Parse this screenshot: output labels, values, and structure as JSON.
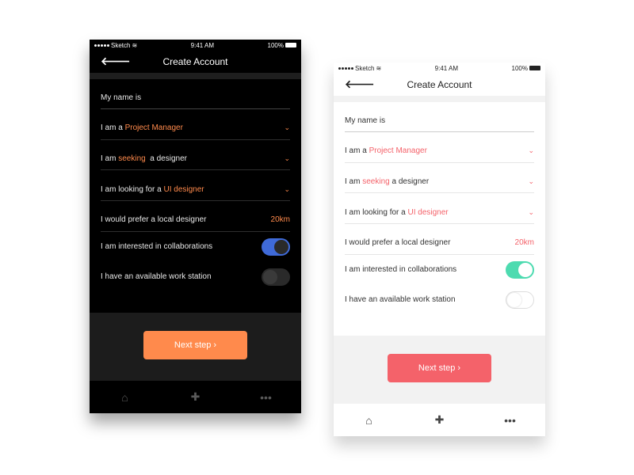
{
  "colors": {
    "dark_accent": "#ff8a4c",
    "light_accent": "#f4626a",
    "dark_toggle_on": "#3f6ad8",
    "light_toggle_on": "#4ddbb0"
  },
  "statusbar": {
    "carrier": "Sketch",
    "time": "9:41 AM",
    "battery": "100%"
  },
  "navbar": {
    "title": "Create Account",
    "back_icon": "arrow-left-icon"
  },
  "form": {
    "name_label": "My name is",
    "role": {
      "prefix": "I am a",
      "value": "Project Manager"
    },
    "seeking": {
      "prefix": "I am",
      "value": "seeking",
      "suffix": "a designer"
    },
    "looking_for": {
      "prefix": "I am looking for a",
      "value": "UI designer"
    },
    "local": {
      "label": "I would prefer a local designer",
      "distance": "20km"
    },
    "collab": {
      "label": "I am interested in collaborations",
      "on": true
    },
    "workstation": {
      "label": "I have an available work station",
      "on": false
    }
  },
  "next_button": {
    "label": "Next step ›"
  },
  "tabbar": {
    "icons": [
      "home-icon",
      "plus-icon",
      "more-icon"
    ]
  }
}
